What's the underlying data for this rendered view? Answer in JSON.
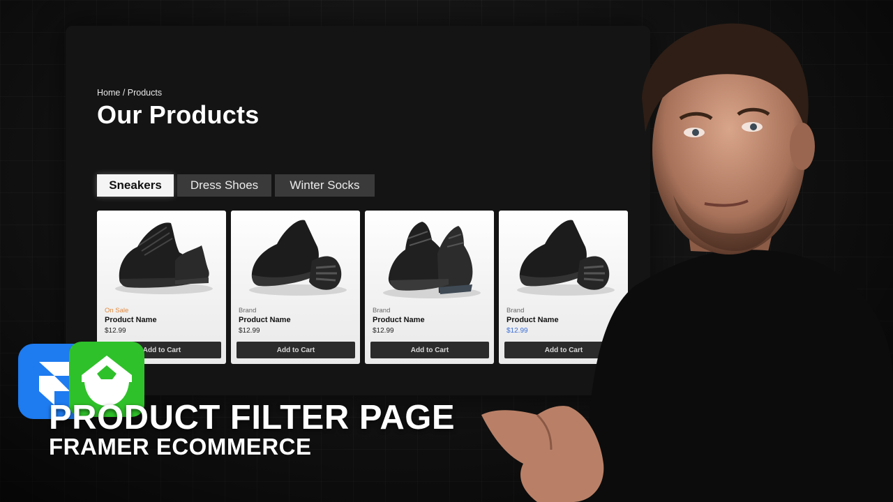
{
  "breadcrumb": "Home / Products",
  "page_title": "Our Products",
  "tabs": [
    {
      "label": "Sneakers",
      "active": true
    },
    {
      "label": "Dress Shoes",
      "active": false
    },
    {
      "label": "Winter Socks",
      "active": false
    }
  ],
  "products": [
    {
      "tag": "On Sale",
      "name": "Product Name",
      "price": "$12.99",
      "button": "Add to Cart"
    },
    {
      "tag": "Brand",
      "name": "Product Name",
      "price": "$12.99",
      "button": "Add to Cart"
    },
    {
      "tag": "Brand",
      "name": "Product Name",
      "price": "$12.99",
      "button": "Add to Cart"
    },
    {
      "tag": "Brand",
      "name": "Product Name",
      "price": "$12.99",
      "button": "Add to Cart"
    }
  ],
  "headline": "PRODUCT FILTER PAGE",
  "subheadline": "FRAMER ECOMMERCE",
  "colors": {
    "sale_tag": "#e2883d",
    "blue_price": "#3b6fd8",
    "framer_logo": "#1e7bf0",
    "green_logo": "#2fc12a"
  },
  "icons": [
    "framer-logo-icon",
    "shopify-like-logo-icon",
    "sneaker-image"
  ]
}
